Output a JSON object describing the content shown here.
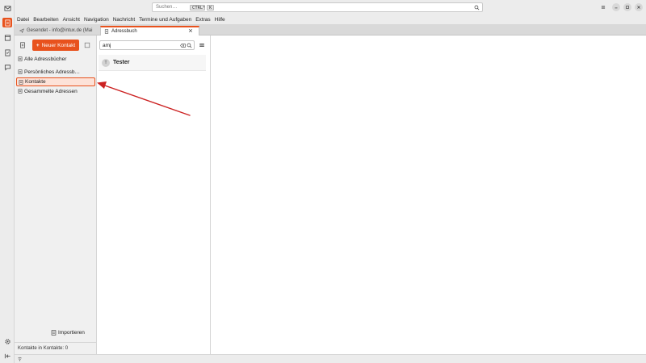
{
  "spaces": {
    "items": [
      {
        "name": "mail",
        "icon": "mail-icon"
      },
      {
        "name": "address-book",
        "icon": "address-book-icon",
        "active": true
      },
      {
        "name": "calendar",
        "icon": "calendar-icon"
      },
      {
        "name": "tasks",
        "icon": "tasks-icon"
      },
      {
        "name": "chat",
        "icon": "chat-icon"
      }
    ],
    "bottom": [
      "settings-icon",
      "collapse-icon"
    ]
  },
  "titlebar": {
    "search_placeholder": "Suchen…",
    "shortcut_key1": "CTRL",
    "shortcut_plus": "+",
    "shortcut_key2": "K"
  },
  "menubar": {
    "items": [
      "Datei",
      "Bearbeiten",
      "Ansicht",
      "Navigation",
      "Nachricht",
      "Termine und Aufgaben",
      "Extras",
      "Hilfe"
    ]
  },
  "tabs": [
    {
      "label": "Gesendet - info@intux.de (Mai",
      "icon": "send-icon",
      "active": false
    },
    {
      "label": "Adressbuch",
      "icon": "address-book-icon",
      "active": true
    }
  ],
  "sidebar": {
    "new_contact_label": "Neuer Kontakt",
    "books": [
      {
        "label": "Alle Adressbücher"
      },
      {
        "label": "Persönliches Adressb…"
      },
      {
        "label": "Kontakte",
        "selected": true
      },
      {
        "label": "Gesammelte Adressen"
      }
    ],
    "import_label": "Importieren",
    "status": "Kontakte in Kontakte: 0"
  },
  "list": {
    "search_value": "amj",
    "contacts": [
      {
        "initial": "T",
        "name": "Tester"
      }
    ]
  },
  "colors": {
    "accent": "#e8521d",
    "selected_bg": "#fde2d8",
    "annotation_arrow": "#cc2222"
  }
}
